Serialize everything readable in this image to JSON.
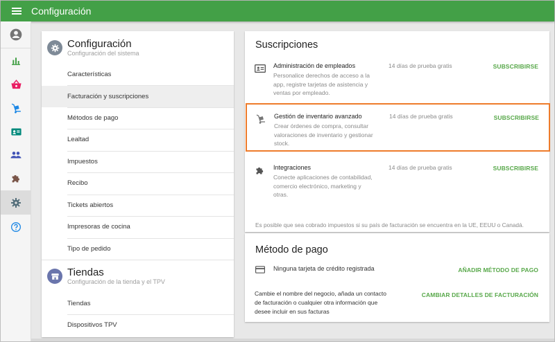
{
  "topbar": {
    "title": "Configuración"
  },
  "rail": {
    "items": [
      {
        "icon": "account-circle-icon",
        "active": false
      },
      {
        "icon": "bar-chart-icon",
        "active": false
      },
      {
        "icon": "basket-icon",
        "active": false
      },
      {
        "icon": "cart-dolly-icon",
        "active": false
      },
      {
        "icon": "badge-card-icon",
        "active": false
      },
      {
        "icon": "people-icon",
        "active": false
      },
      {
        "icon": "puzzle-icon",
        "active": false
      },
      {
        "icon": "gear-icon",
        "active": true
      },
      {
        "icon": "help-circle-icon",
        "active": false
      }
    ]
  },
  "settings_menu": {
    "config_section": {
      "title": "Configuración",
      "subtitle": "Configuración del sistema"
    },
    "config_items": [
      {
        "label": "Características"
      },
      {
        "label": "Facturación y suscripciones",
        "active": true
      },
      {
        "label": "Métodos de pago"
      },
      {
        "label": "Lealtad"
      },
      {
        "label": "Impuestos"
      },
      {
        "label": "Recibo"
      },
      {
        "label": "Tickets abiertos"
      },
      {
        "label": "Impresoras de cocina"
      },
      {
        "label": "Tipo de pedido"
      }
    ],
    "stores_section": {
      "title": "Tiendas",
      "subtitle": "Configuración de la tienda y el TPV"
    },
    "stores_items": [
      {
        "label": "Tiendas"
      },
      {
        "label": "Dispositivos TPV"
      }
    ]
  },
  "subscriptions": {
    "title": "Suscripciones",
    "items": [
      {
        "icon": "employee-card-icon",
        "name": "Administración de empleados",
        "description": "Personalice derechos de acceso a la app, registre tarjetas de asistencia y ventas por empleado.",
        "trial": "14 días de prueba gratis",
        "button": "SUBSCRIBIRSE"
      },
      {
        "icon": "inventory-dolly-icon",
        "name": "Gestión de inventario avanzado",
        "description": "Crear órdenes de compra, consultar valoraciones de inventario y gestionar stock.",
        "trial": "14 días de prueba gratis",
        "button": "SUBSCRIBIRSE",
        "highlighted": true
      },
      {
        "icon": "puzzle-icon",
        "name": "Integraciones",
        "description": "Conecte aplicaciones de contabilidad, comercio electrónico, marketing y otras.",
        "trial": "14 días de prueba gratis",
        "button": "SUBSCRIBIRSE"
      }
    ],
    "tax_note": "Es posible que sea cobrado impuestos si su país de facturación se encuentra en la UE, EEUU o Canadá."
  },
  "payment": {
    "title": "Método de pago",
    "card_text": "Ninguna tarjeta de crédito registrada",
    "add_button": "AÑADIR MÉTODO DE PAGO",
    "billing_text": "Cambie el nombre del negocio, añada un contacto de facturación o cualquier otra información que desee incluir en sus facturas",
    "billing_button": "CAMBIAR DETALLES DE FACTURACIÓN"
  },
  "colors": {
    "topbar": "#43a047",
    "accent_button": "#58a84a",
    "highlight_border": "#ee7b2a"
  }
}
